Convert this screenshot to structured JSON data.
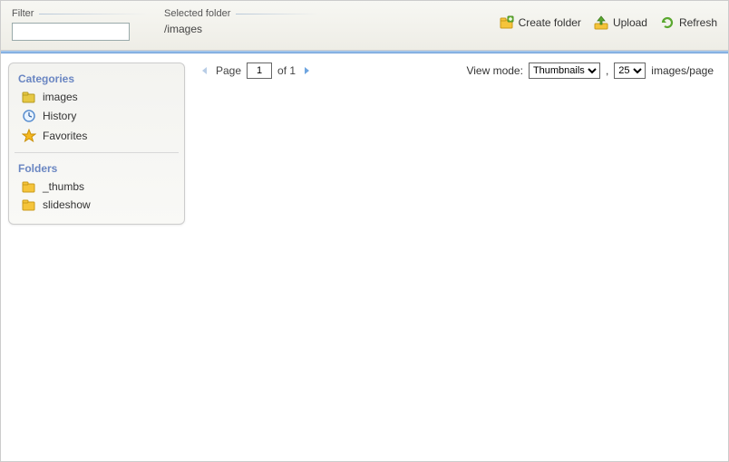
{
  "toolbar": {
    "filter_label": "Filter",
    "filter_value": "",
    "selected_folder_label": "Selected folder",
    "selected_folder_path": "/images",
    "create_folder_label": "Create folder",
    "upload_label": "Upload",
    "refresh_label": "Refresh"
  },
  "sidebar": {
    "categories_title": "Categories",
    "categories": [
      {
        "label": "images"
      },
      {
        "label": "History"
      },
      {
        "label": "Favorites"
      }
    ],
    "folders_title": "Folders",
    "folders": [
      {
        "label": "_thumbs"
      },
      {
        "label": "slideshow"
      }
    ]
  },
  "pager": {
    "page_label": "Page",
    "current_page": "1",
    "of_label": "of 1"
  },
  "view": {
    "label": "View mode:",
    "mode_options": [
      "Thumbnails"
    ],
    "mode_selected": "Thumbnails",
    "comma": ",",
    "count_options": [
      "25"
    ],
    "count_selected": "25",
    "suffix": "images/page"
  }
}
